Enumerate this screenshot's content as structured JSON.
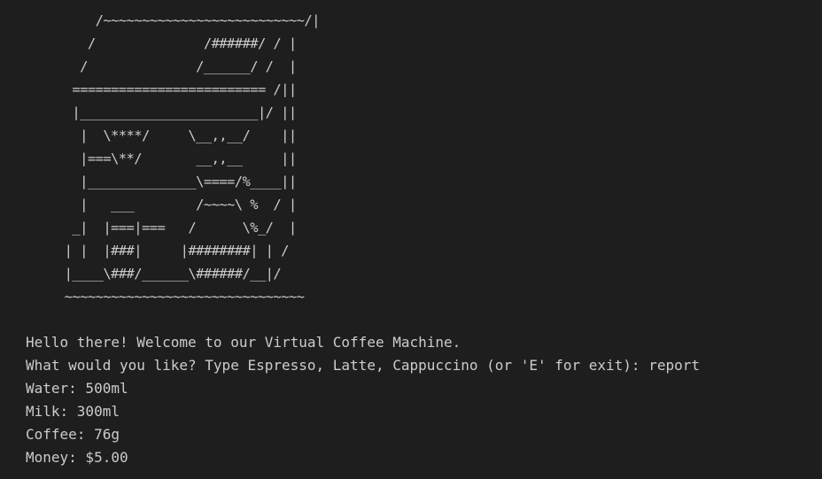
{
  "terminal": {
    "background": "#1e1e1e",
    "foreground": "#cccccc",
    "ascii_art": [
      "         /~~~~~~~~~~~~~~~~~~~~~~~~~~/|",
      "        /              /######/ / |",
      "       /              /______/ /  |",
      "      ========================= /||",
      "      |_______________________|/ ||",
      "       |  \\****/     \\__,,__/    ||",
      "       |===\\**/       __,,__     ||",
      "       |______________\\====/%____||",
      "       |   ___        /~~~~\\ %  / |",
      "      _|  |===|===   /      \\%_/  |",
      "     | |  |###|     |########| | /",
      "     |____\\###/______\\######/__|/",
      "     ~~~~~~~~~~~~~~~~~~~~~~~~~~~~~~~"
    ],
    "greeting": "Hello there! Welcome to our Virtual Coffee Machine.",
    "prompt": "What would you like? Type Espresso, Latte, Cappuccino (or 'E' for exit): ",
    "user_input": "report",
    "report": {
      "water": "Water: 500ml",
      "milk": "Milk: 300ml",
      "coffee": "Coffee: 76g",
      "money": "Money: $5.00"
    }
  }
}
